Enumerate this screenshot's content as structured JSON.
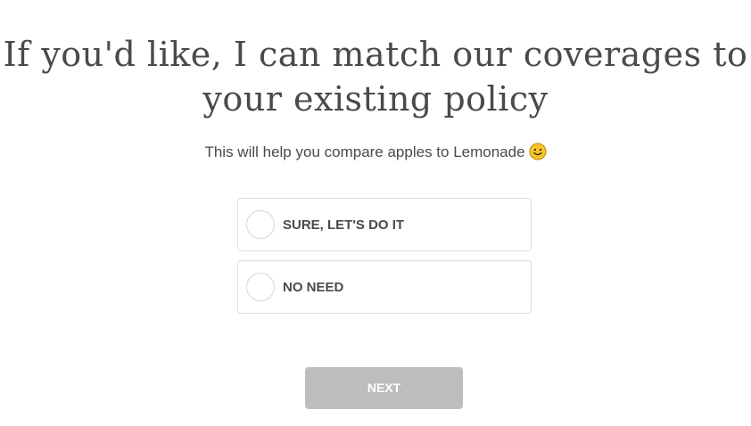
{
  "question": {
    "title": "If you'd like, I can match our coverages to your existing policy",
    "subtitle": "This will help you compare apples to Lemonade",
    "subtitle_icon": "smiley-face-icon"
  },
  "options": [
    {
      "label": "SURE, LET'S DO IT",
      "selected": false
    },
    {
      "label": "NO NEED",
      "selected": false
    }
  ],
  "next_button": {
    "label": "NEXT",
    "enabled": false
  },
  "colors": {
    "text": "#4a4a4a",
    "border": "#dcdcdc",
    "button_disabled": "#bdbdbd",
    "emoji": "#f5c518"
  }
}
